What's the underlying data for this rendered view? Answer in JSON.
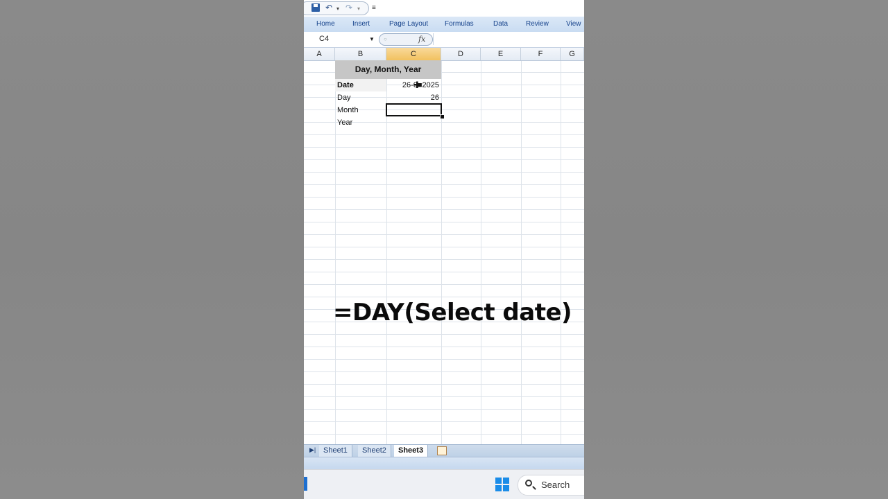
{
  "ribbon": {
    "tabs": [
      "Home",
      "Insert",
      "Page Layout",
      "Formulas",
      "Data",
      "Review",
      "View"
    ]
  },
  "formula_bar": {
    "name_box": "C4",
    "fx": "fx"
  },
  "grid": {
    "columns": [
      "A",
      "B",
      "C",
      "D",
      "E",
      "F",
      "G"
    ],
    "active_column": "C",
    "title": "Day, Month, Year",
    "rows": [
      {
        "label": "Date",
        "value": "26-0■2025"
      },
      {
        "label": "Day",
        "value": "26"
      },
      {
        "label": "Month",
        "value": ""
      },
      {
        "label": "Year",
        "value": ""
      }
    ]
  },
  "overlay": {
    "text": "=DAY(Select date)"
  },
  "sheets": {
    "tabs": [
      "Sheet1",
      "Sheet2",
      "Sheet3"
    ],
    "active": "Sheet3"
  },
  "taskbar": {
    "search_label": "Search"
  },
  "colors": {
    "ribbon_text": "#15428b",
    "active_column_header": "#f1c15f",
    "title_fill": "#c6c6c6",
    "windows_accent": "#1a8ce8"
  }
}
